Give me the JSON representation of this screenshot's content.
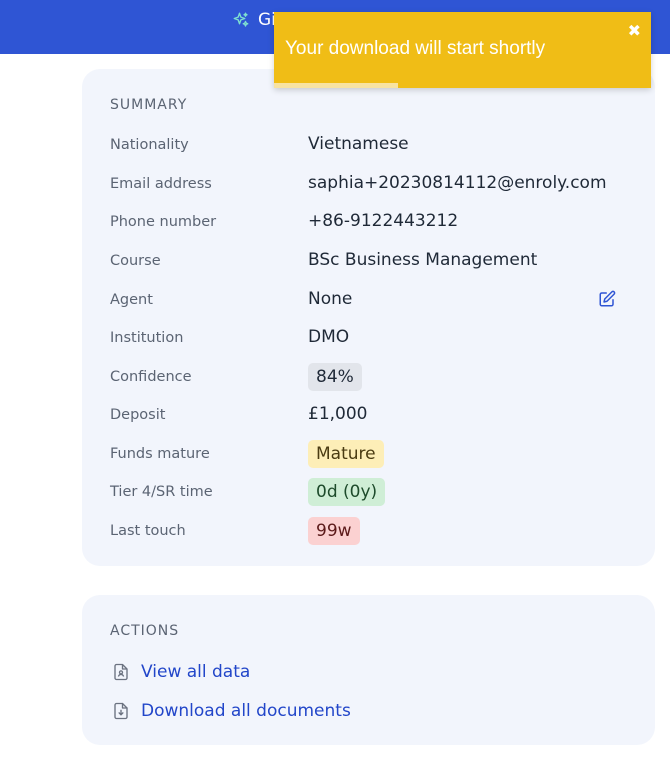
{
  "header": {
    "title": "Gi",
    "sparkle_icon": "sparkle-icon",
    "color": "#2f55d4"
  },
  "toast": {
    "message": "Your download will start shortly",
    "close_icon": "close-icon",
    "progress_fraction": 0.33,
    "color": "#f0bd16"
  },
  "summary": {
    "title": "SUMMARY",
    "rows": [
      {
        "label": "Nationality",
        "value": "Vietnamese"
      },
      {
        "label": "Email address",
        "value": "saphia+20230814112@enroly.com"
      },
      {
        "label": "Phone number",
        "value": "+86-9122443212"
      },
      {
        "label": "Course",
        "value": "BSc Business Management"
      },
      {
        "label": "Agent",
        "value": "None",
        "edit_icon": "edit-icon"
      },
      {
        "label": "Institution",
        "value": "DMO"
      },
      {
        "label": "Confidence",
        "value": "84%",
        "badge": "gray"
      },
      {
        "label": "Deposit",
        "value": "£1,000"
      },
      {
        "label": "Funds mature",
        "value": "Mature",
        "badge": "yellow"
      },
      {
        "label": "Tier 4/SR time",
        "value": "0d (0y)",
        "badge": "green"
      },
      {
        "label": "Last touch",
        "value": "99w",
        "badge": "red"
      }
    ]
  },
  "actions": {
    "title": "ACTIONS",
    "items": [
      {
        "label": "View all data",
        "icon": "file-user-icon"
      },
      {
        "label": "Download all documents",
        "icon": "file-download-icon"
      }
    ]
  }
}
